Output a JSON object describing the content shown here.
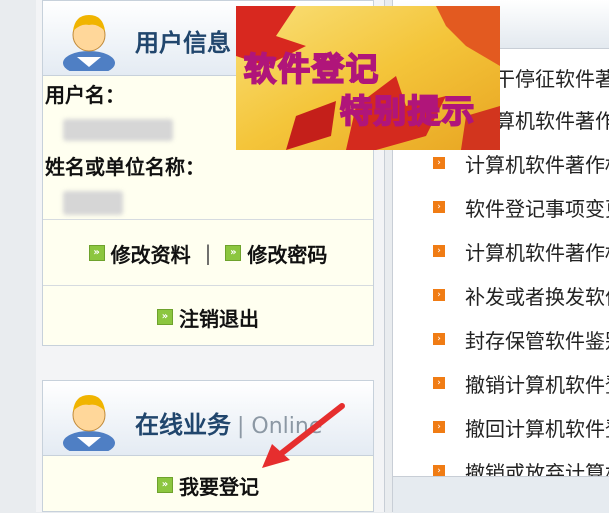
{
  "user_panel": {
    "title": "用户信息",
    "username_label": "用户名：",
    "name_label": "姓名或单位名称：",
    "edit_profile": "修改资料",
    "separator": "|",
    "change_password": "修改密码",
    "logout": "注销退出"
  },
  "online_panel": {
    "title": "在线业务",
    "subtitle": "| Online",
    "register": "我要登记"
  },
  "banner": {
    "line1": "软件登记",
    "line2": "特别提示"
  },
  "news": [
    "计算机软件著作权",
    "计算机软件著作权",
    "软件登记事项变更",
    "计算机软件著作权",
    "补发或者换发软件",
    "封存保管软件鉴别",
    "撤销计算机软件登",
    "撤回计算机软件登",
    "撤销或放弃计算机"
  ],
  "news_partial_top": [
    "干停征软件著",
    "算机软件著作"
  ],
  "colors": {
    "title": "#21466d",
    "bullet": "#f07c14",
    "action_icon": "#8cc63f"
  }
}
